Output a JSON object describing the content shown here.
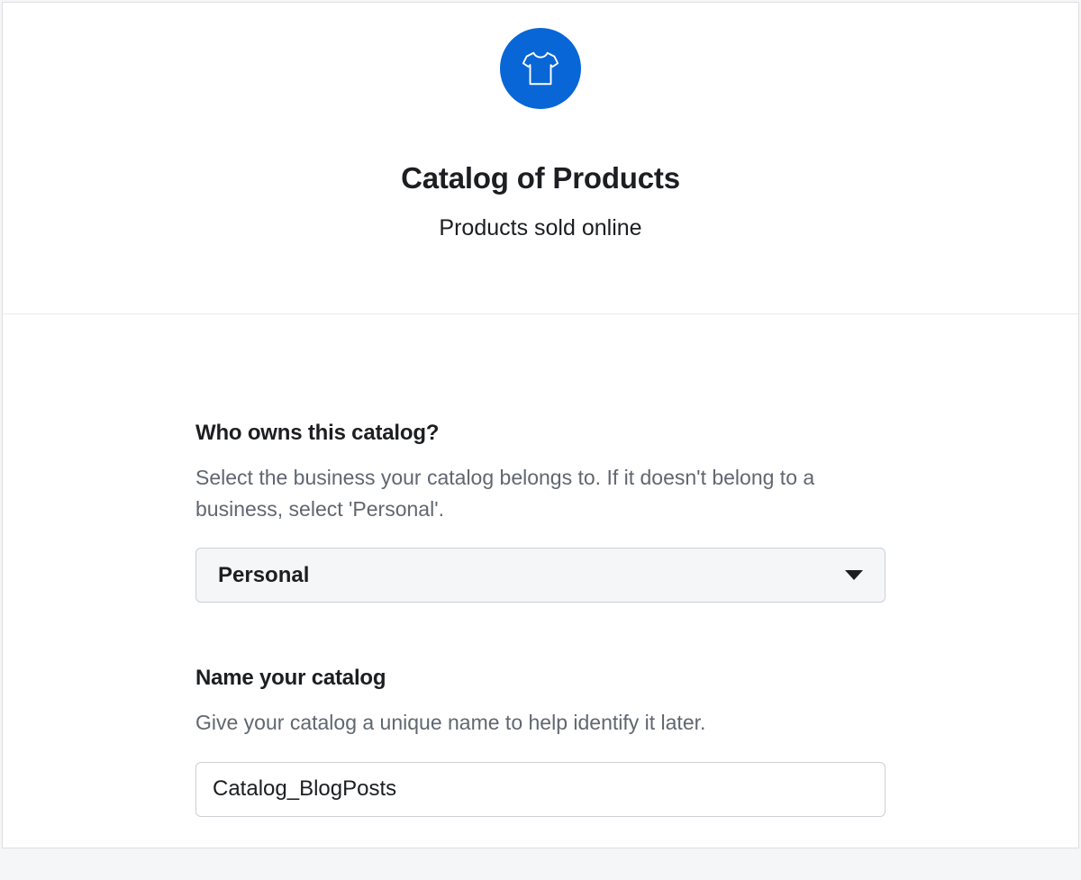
{
  "header": {
    "icon": "tshirt-icon",
    "title": "Catalog of Products",
    "subtitle": "Products sold online"
  },
  "owner_field": {
    "label": "Who owns this catalog?",
    "help": "Select the business your catalog belongs to. If it doesn't belong to a business, select 'Personal'.",
    "selected": "Personal"
  },
  "name_field": {
    "label": "Name your catalog",
    "help": "Give your catalog a unique name to help identify it later.",
    "value": "Catalog_BlogPosts"
  },
  "colors": {
    "accent": "#0866d6",
    "text_primary": "#1c1e21",
    "text_secondary": "#606770",
    "border": "#ccd0d5",
    "bg_muted": "#f5f6f7"
  }
}
